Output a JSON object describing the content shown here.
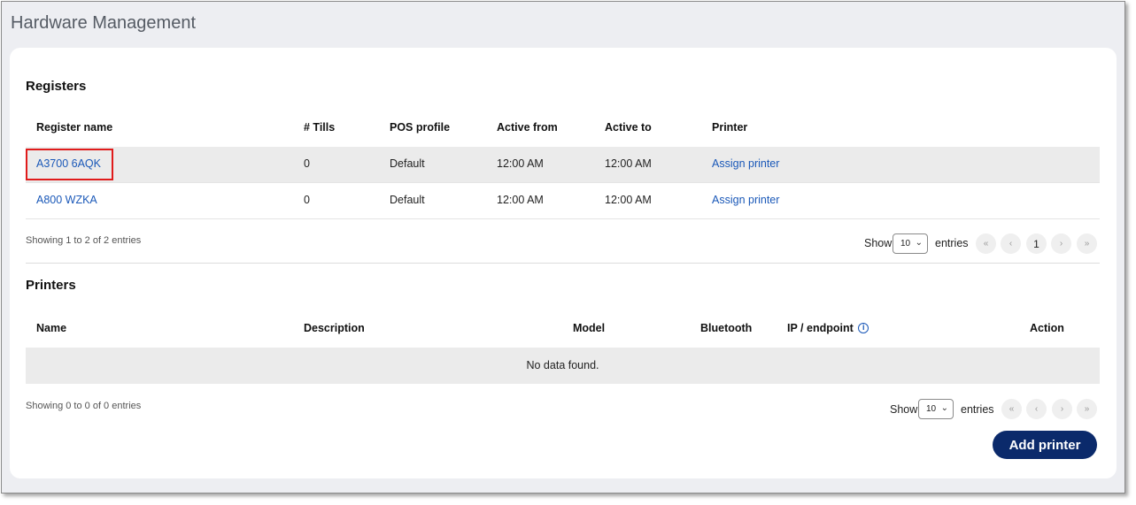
{
  "page_title": "Hardware Management",
  "registers": {
    "title": "Registers",
    "columns": [
      "Register name",
      "# Tills",
      "POS profile",
      "Active from",
      "Active to",
      "Printer"
    ],
    "rows": [
      {
        "name": "A3700 6AQK",
        "tills": "0",
        "profile": "Default",
        "from": "12:00 AM",
        "to": "12:00 AM",
        "printer": "Assign printer"
      },
      {
        "name": "A800 WZKA",
        "tills": "0",
        "profile": "Default",
        "from": "12:00 AM",
        "to": "12:00 AM",
        "printer": "Assign printer"
      }
    ],
    "showing": "Showing 1 to 2 of 2 entries",
    "show_label": "Show",
    "page_size": "10",
    "entries_label": "entries",
    "pagination": {
      "first": "«",
      "prev": "‹",
      "current": "1",
      "next": "›",
      "last": "»"
    }
  },
  "printers": {
    "title": "Printers",
    "columns": [
      "Name",
      "Description",
      "Model",
      "Bluetooth",
      "IP / endpoint",
      "Action"
    ],
    "empty": "No data found.",
    "showing": "Showing 0 to 0 of 0 entries",
    "show_label": "Show",
    "page_size": "10",
    "entries_label": "entries",
    "pagination": {
      "first": "«",
      "prev": "‹",
      "next": "›",
      "last": "»"
    },
    "add_button": "Add printer"
  },
  "colors": {
    "link": "#1a58b8",
    "primary_button": "#0b2a6b",
    "highlight": "#e01b1b"
  },
  "icons": {
    "info": "info-circle-icon",
    "dropdown": "chevron-down-icon"
  }
}
